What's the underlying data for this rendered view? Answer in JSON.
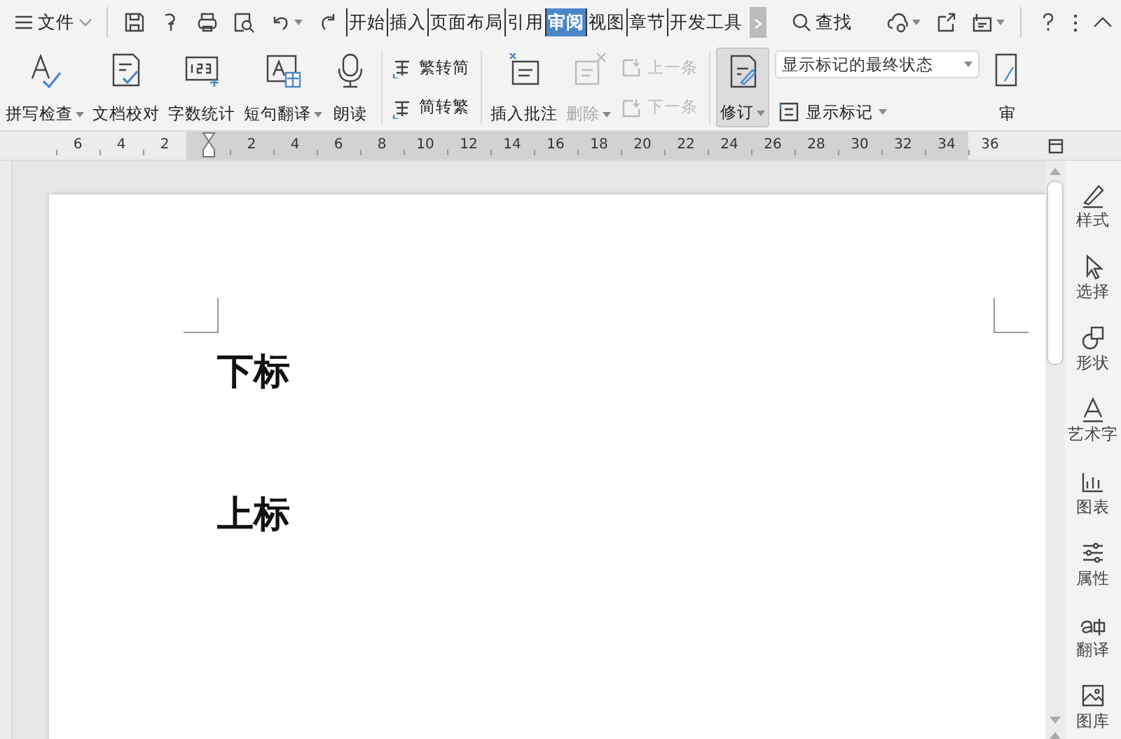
{
  "menu": {
    "label": "文件"
  },
  "tabs": [
    {
      "label": "开始",
      "selected": false
    },
    {
      "label": "插入",
      "selected": false
    },
    {
      "label": "页面布局",
      "selected": false
    },
    {
      "label": "引用",
      "selected": false
    },
    {
      "label": "审阅",
      "selected": true
    },
    {
      "label": "视图",
      "selected": false
    },
    {
      "label": "章节",
      "selected": false
    },
    {
      "label": "开发工具",
      "selected": false
    }
  ],
  "search": {
    "label": "查找"
  },
  "ribbon": [
    {
      "kind": "big",
      "label": "拼写检查",
      "dropdown": true,
      "disabled": false,
      "pressed": false
    },
    {
      "kind": "big",
      "label": "文档校对",
      "dropdown": false,
      "disabled": false,
      "pressed": false
    },
    {
      "kind": "big",
      "label": "字数统计",
      "dropdown": false,
      "disabled": false,
      "pressed": false
    },
    {
      "kind": "big",
      "label": "短句翻译",
      "dropdown": true,
      "disabled": false,
      "pressed": false
    },
    {
      "kind": "big",
      "label": "朗读",
      "dropdown": false,
      "disabled": false,
      "pressed": false
    },
    {
      "kind": "sep"
    },
    {
      "kind": "pair",
      "items": [
        {
          "label": "繁转简",
          "disabled": false
        },
        {
          "label": "简转繁",
          "disabled": false
        }
      ]
    },
    {
      "kind": "sep"
    },
    {
      "kind": "big",
      "label": "插入批注",
      "dropdown": false,
      "disabled": false,
      "pressed": false
    },
    {
      "kind": "big",
      "label": "删除",
      "dropdown": true,
      "disabled": true,
      "pressed": false
    },
    {
      "kind": "pair",
      "items": [
        {
          "label": "上一条",
          "disabled": true
        },
        {
          "label": "下一条",
          "disabled": true
        }
      ]
    },
    {
      "kind": "sep"
    },
    {
      "kind": "big",
      "label": "修订",
      "dropdown": true,
      "disabled": false,
      "pressed": true
    },
    {
      "kind": "markup",
      "value": "显示标记的最终状态",
      "label": "显示标记"
    },
    {
      "kind": "big",
      "label": "审",
      "dropdown": false,
      "disabled": false,
      "pressed": false
    }
  ],
  "ruler": [
    "6",
    "4",
    "2",
    "2",
    "4",
    "6",
    "8",
    "10",
    "12",
    "14",
    "16",
    "18",
    "20",
    "22",
    "24",
    "26",
    "28",
    "30",
    "32",
    "34",
    "36"
  ],
  "document": {
    "headings": [
      "下标",
      "上标"
    ]
  },
  "sidebar": [
    {
      "label": "样式"
    },
    {
      "label": "选择"
    },
    {
      "label": "形状"
    },
    {
      "label": "艺术字"
    },
    {
      "label": "图表"
    },
    {
      "label": "属性"
    },
    {
      "label": "翻译"
    },
    {
      "label": "图库"
    }
  ]
}
